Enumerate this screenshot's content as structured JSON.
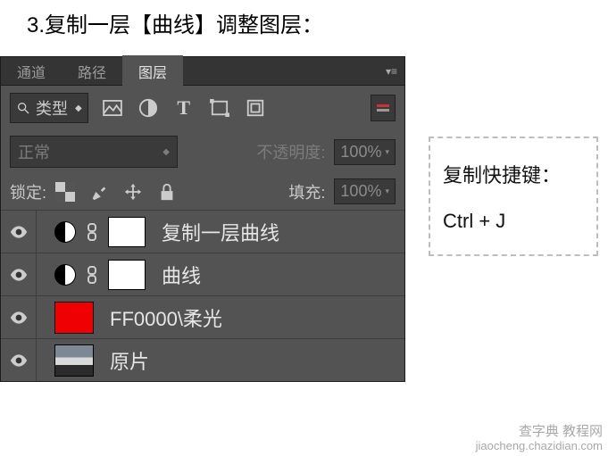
{
  "instruction": "3.复制一层【曲线】调整图层：",
  "tabs": {
    "channel": "通道",
    "path": "路径",
    "layers": "图层"
  },
  "filter": {
    "type_label": "类型"
  },
  "blend": {
    "mode": "正常",
    "opacity_label": "不透明度:",
    "opacity_value": "100%"
  },
  "lock": {
    "label": "锁定:",
    "fill_label": "填充:",
    "fill_value": "100%"
  },
  "layers_list": [
    {
      "name": "复制一层曲线"
    },
    {
      "name": "曲线"
    },
    {
      "name": "FF0000\\柔光"
    },
    {
      "name": "原片"
    }
  ],
  "sidenote": {
    "title": "复制快捷键：",
    "keys": "Ctrl + J"
  },
  "watermark": {
    "line1": "查字典 教程网",
    "line2": "jiaocheng.chazidian.com"
  }
}
